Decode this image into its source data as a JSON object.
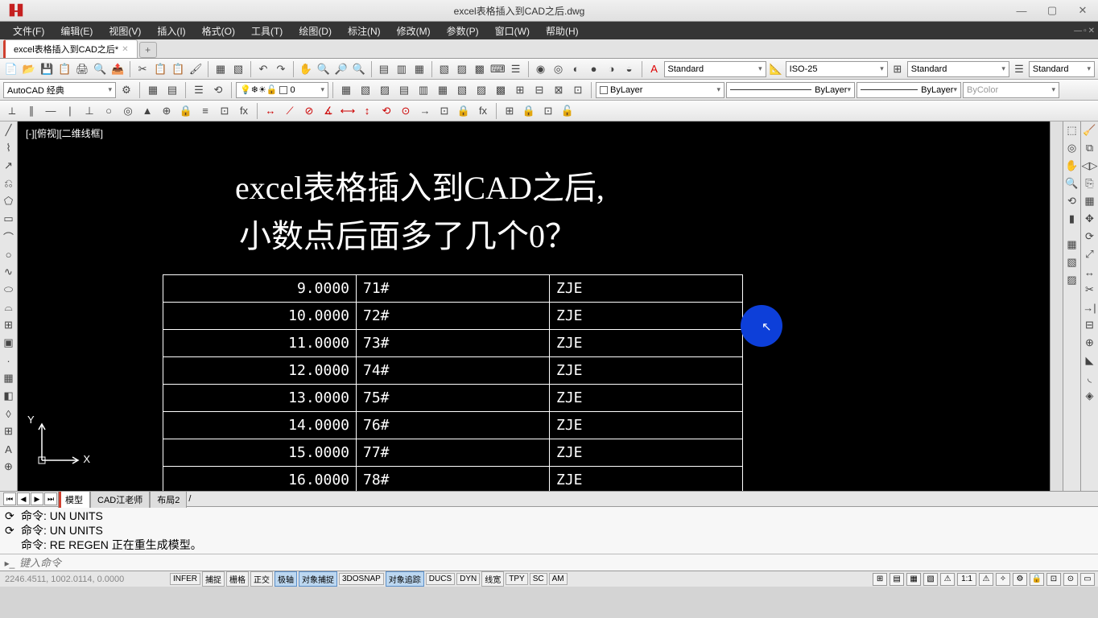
{
  "titlebar": {
    "filename": "excel表格插入到CAD之后.dwg"
  },
  "menu": {
    "file": "文件(F)",
    "edit": "编辑(E)",
    "view": "视图(V)",
    "insert": "插入(I)",
    "format": "格式(O)",
    "tools": "工具(T)",
    "draw": "绘图(D)",
    "dimension": "标注(N)",
    "modify": "修改(M)",
    "param": "参数(P)",
    "window": "窗口(W)",
    "help": "帮助(H)"
  },
  "filetab": {
    "name": "excel表格插入到CAD之后*"
  },
  "workspace": {
    "label": "AutoCAD 经典"
  },
  "styleboxes": {
    "textstyle": "Standard",
    "dimstyle": "ISO-25",
    "tablestyle": "Standard",
    "mlstyle": "Standard"
  },
  "layer": {
    "name": "0",
    "linetype": "ByLayer",
    "lineweight": "ByLayer",
    "plotstyle": "ByLayer",
    "color": "ByColor"
  },
  "viewport": {
    "label": "[-][俯视][二维线框]"
  },
  "drawing": {
    "heading1": "excel表格插入到CAD之后,",
    "heading2": "小数点后面多了几个0？",
    "table": [
      {
        "c1": "9.0000",
        "c2": "71#",
        "c3": "ZJE"
      },
      {
        "c1": "10.0000",
        "c2": "72#",
        "c3": "ZJE"
      },
      {
        "c1": "11.0000",
        "c2": "73#",
        "c3": "ZJE"
      },
      {
        "c1": "12.0000",
        "c2": "74#",
        "c3": "ZJE"
      },
      {
        "c1": "13.0000",
        "c2": "75#",
        "c3": "ZJE"
      },
      {
        "c1": "14.0000",
        "c2": "76#",
        "c3": "ZJE"
      },
      {
        "c1": "15.0000",
        "c2": "77#",
        "c3": "ZJE"
      },
      {
        "c1": "16.0000",
        "c2": "78#",
        "c3": "ZJE"
      }
    ]
  },
  "layouttabs": {
    "t1": "模型",
    "t2": "CAD江老师",
    "t3": "布局2"
  },
  "cmd": {
    "l1": "命令:  UN UNITS",
    "l2": "命令:  UN UNITS",
    "l3": "命令:  RE REGEN 正在重生成模型。",
    "placeholder": "键入命令"
  },
  "status": {
    "coords": "2246.4511, 1002.0114,  0.0000",
    "toggles": [
      "INFER",
      "捕捉",
      "栅格",
      "正交",
      "极轴",
      "对象捕捉",
      "3DOSNAP",
      "对象追踪",
      "DUCS",
      "DYN",
      "线宽",
      "TPY",
      "SC",
      "AM"
    ],
    "scale": "1:1",
    "ucs": {
      "y": "Y",
      "x": "X"
    }
  }
}
